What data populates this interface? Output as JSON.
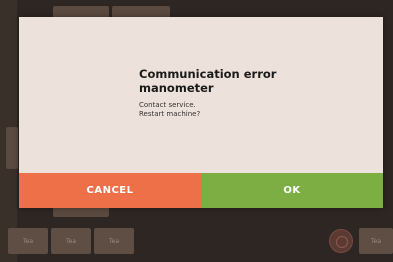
{
  "background": {
    "bottom_tabs": [
      "Tea",
      "Tea",
      "Tea",
      "Tea"
    ]
  },
  "dialog": {
    "title": "Communication error\nmanometer",
    "message_line1": "Contact service.",
    "message_line2": "Restart machine?",
    "cancel_label": "CANCEL",
    "ok_label": "OK"
  },
  "colors": {
    "cancel": "#ee7048",
    "ok": "#7cae44",
    "dialog_bg": "#ede2db"
  }
}
